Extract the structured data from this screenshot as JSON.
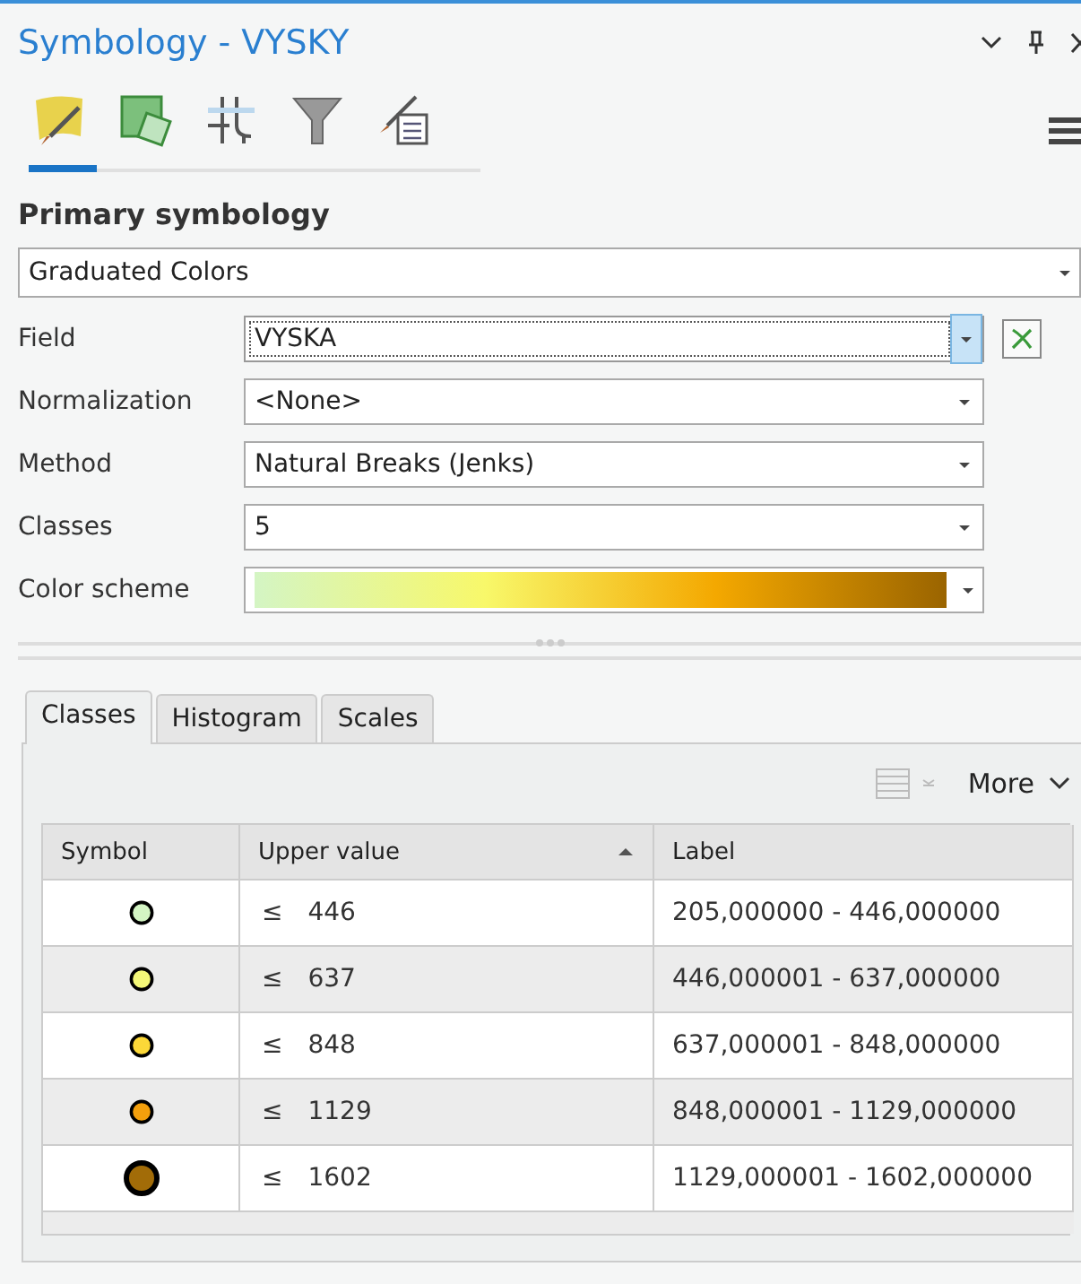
{
  "window": {
    "title": "Symbology - VYSKY"
  },
  "tools": [
    {
      "kind": "primary",
      "selected": true
    },
    {
      "kind": "vary",
      "selected": false
    },
    {
      "kind": "grid",
      "selected": false
    },
    {
      "kind": "filter",
      "selected": false
    },
    {
      "kind": "labels",
      "selected": false
    }
  ],
  "section_title": "Primary symbology",
  "renderer": {
    "value": "Graduated Colors"
  },
  "form": [
    {
      "kind": "field",
      "label": "Field",
      "value": "VYSKA",
      "focused": true
    },
    {
      "kind": "select",
      "label": "Normalization",
      "value": "<None>",
      "focused": false
    },
    {
      "kind": "select",
      "label": "Method",
      "value": "Natural Breaks (Jenks)",
      "focused": false
    },
    {
      "kind": "select",
      "label": "Classes",
      "value": "5",
      "focused": false
    },
    {
      "kind": "ramp",
      "label": "Color scheme"
    }
  ],
  "tabs": [
    {
      "label": "Classes",
      "selected": true
    },
    {
      "label": "Histogram",
      "selected": false
    },
    {
      "label": "Scales",
      "selected": false
    }
  ],
  "more": "More",
  "table": {
    "columns": [
      "Symbol",
      "Upper value",
      "Label"
    ],
    "rows": [
      {
        "color": "#d4f5c4",
        "kind": "small",
        "op": "≤",
        "value": "446",
        "label": "205,000000 - 446,000000"
      },
      {
        "color": "#f4f878",
        "kind": "small",
        "op": "≤",
        "value": "637",
        "label": "446,000001 - 637,000000"
      },
      {
        "color": "#fcd838",
        "kind": "small",
        "op": "≤",
        "value": "848",
        "label": "637,000001 - 848,000000"
      },
      {
        "color": "#f4a00c",
        "kind": "small",
        "op": "≤",
        "value": "1129",
        "label": "848,000001 - 1129,000000"
      },
      {
        "color": "#a26c08",
        "kind": "large",
        "op": "≤",
        "value": "1602",
        "label": "1129,000001 - 1602,000000"
      }
    ]
  }
}
